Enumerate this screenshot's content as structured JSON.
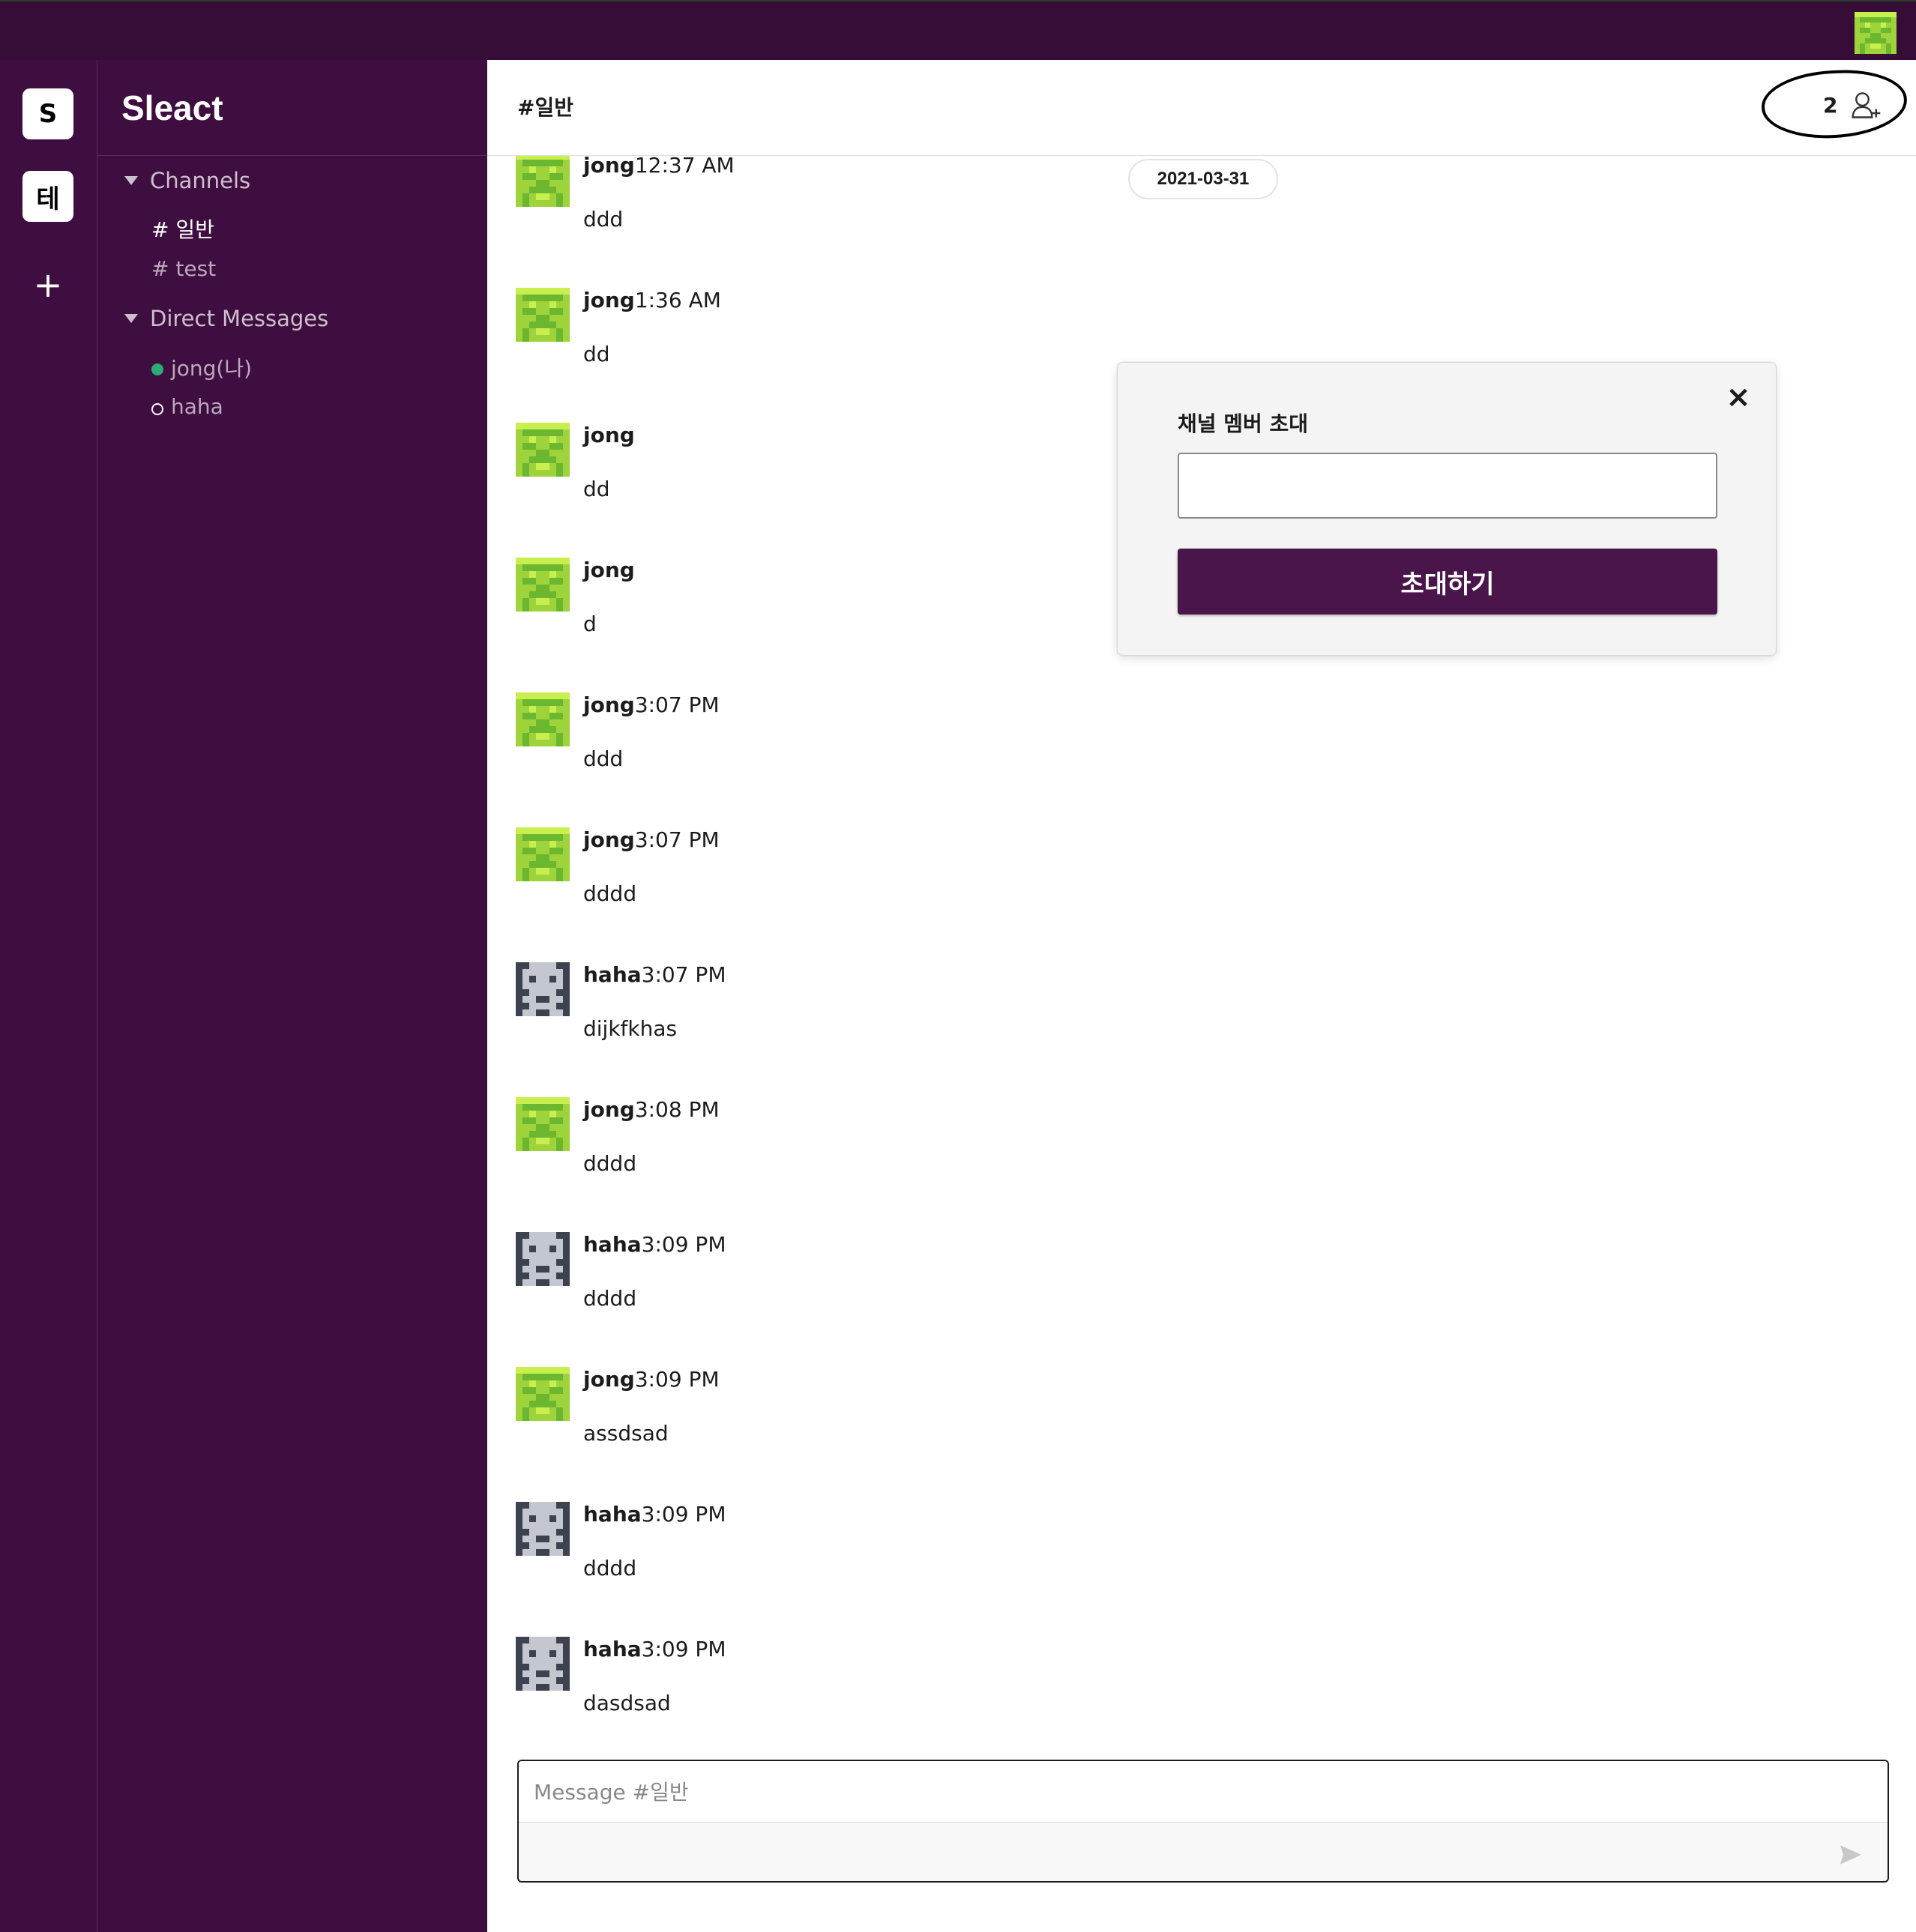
{
  "app": {
    "workspace_name": "Sleact",
    "workspaces": [
      {
        "label": "S"
      },
      {
        "label": "테"
      }
    ],
    "add_workspace_label": "+"
  },
  "sidebar": {
    "channels_label": "Channels",
    "channels": [
      {
        "label": "# 일반",
        "active": true
      },
      {
        "label": "# test",
        "active": false
      }
    ],
    "dm_label": "Direct Messages",
    "dms": [
      {
        "label": "jong(나)",
        "online": true
      },
      {
        "label": "haha",
        "online": false
      }
    ]
  },
  "channel": {
    "title": "#일반",
    "member_count": "2",
    "date_divider": "2021-03-31"
  },
  "messages": [
    {
      "user": "jong",
      "time": "12:37 AM",
      "text": "ddd",
      "avatar": "green-pixel-avatar"
    },
    {
      "user": "jong",
      "time": "1:36 AM",
      "text": "dd",
      "avatar": "green-pixel-avatar"
    },
    {
      "user": "jong",
      "time": "",
      "text": "dd",
      "avatar": "green-pixel-avatar"
    },
    {
      "user": "jong",
      "time": "",
      "text": "d",
      "avatar": "green-pixel-avatar"
    },
    {
      "user": "jong",
      "time": "3:07 PM",
      "text": "ddd",
      "avatar": "green-pixel-avatar"
    },
    {
      "user": "jong",
      "time": "3:07 PM",
      "text": "dddd",
      "avatar": "green-pixel-avatar"
    },
    {
      "user": "haha",
      "time": "3:07 PM",
      "text": "dijkfkhas",
      "avatar": "gray-pixel-avatar"
    },
    {
      "user": "jong",
      "time": "3:08 PM",
      "text": "dddd",
      "avatar": "green-pixel-avatar"
    },
    {
      "user": "haha",
      "time": "3:09 PM",
      "text": "dddd",
      "avatar": "gray-pixel-avatar"
    },
    {
      "user": "jong",
      "time": "3:09 PM",
      "text": "assdsad",
      "avatar": "green-pixel-avatar"
    },
    {
      "user": "haha",
      "time": "3:09 PM",
      "text": "dddd",
      "avatar": "gray-pixel-avatar"
    },
    {
      "user": "haha",
      "time": "3:09 PM",
      "text": "dasdsad",
      "avatar": "gray-pixel-avatar"
    }
  ],
  "compose": {
    "placeholder": "Message #일반"
  },
  "invite_modal": {
    "title": "채널 멤버 초대",
    "input_value": "",
    "button_label": "초대하기",
    "close_label": "×"
  },
  "colors": {
    "topbar": "#350d36",
    "sidebar": "#3f0e40",
    "accent": "#4a154b",
    "online": "#2bac76"
  }
}
